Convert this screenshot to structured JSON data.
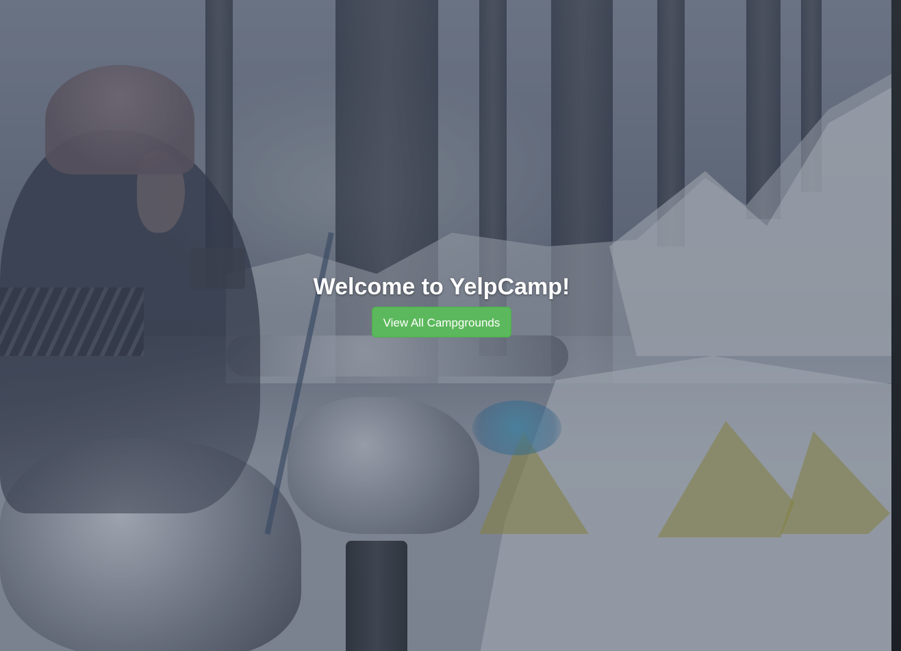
{
  "landing": {
    "title": "Welcome to YelpCamp!",
    "button_label": "View All Campgrounds",
    "button_color": "#5cb85c",
    "overlay_color": "#283042"
  }
}
